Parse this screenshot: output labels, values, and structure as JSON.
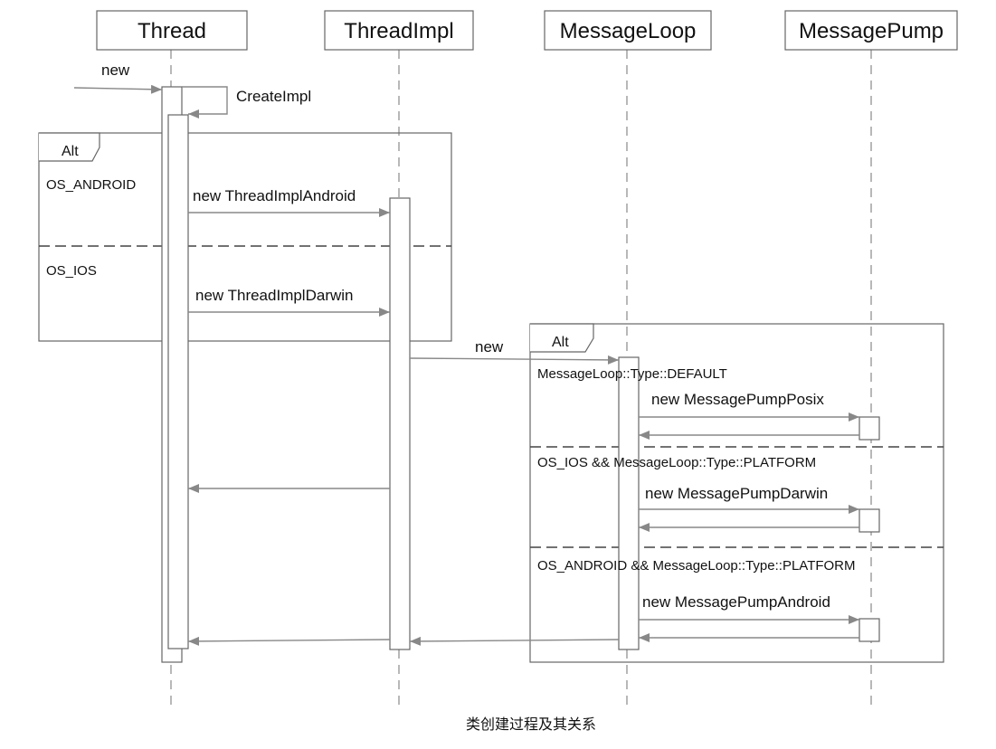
{
  "participants": [
    {
      "id": "thread",
      "label": "Thread"
    },
    {
      "id": "threadimpl",
      "label": "ThreadImpl"
    },
    {
      "id": "messageloop",
      "label": "MessageLoop"
    },
    {
      "id": "messagepump",
      "label": "MessagePump"
    }
  ],
  "messages": {
    "thread_new": "new",
    "create_impl": "CreateImpl",
    "new_android": "new ThreadImplAndroid",
    "new_darwin": "new ThreadImplDarwin",
    "messageloop_new": "new",
    "new_posix": "new MessagePumpPosix",
    "new_pump_darwin": "new MessagePumpDarwin",
    "new_pump_android": "new MessagePumpAndroid"
  },
  "frames": {
    "alt1": {
      "tag": "Alt",
      "conditions": [
        "OS_ANDROID",
        "OS_IOS"
      ]
    },
    "alt2": {
      "tag": "Alt",
      "conditions": [
        "MessageLoop::Type::DEFAULT",
        "OS_IOS && MessageLoop::Type::PLATFORM",
        "OS_ANDROID && MessageLoop::Type::PLATFORM"
      ]
    }
  },
  "caption": "类创建过程及其关系",
  "colors": {
    "line": "#777777",
    "arrow": "#888888",
    "box_border": "#666666",
    "text": "#111111"
  }
}
